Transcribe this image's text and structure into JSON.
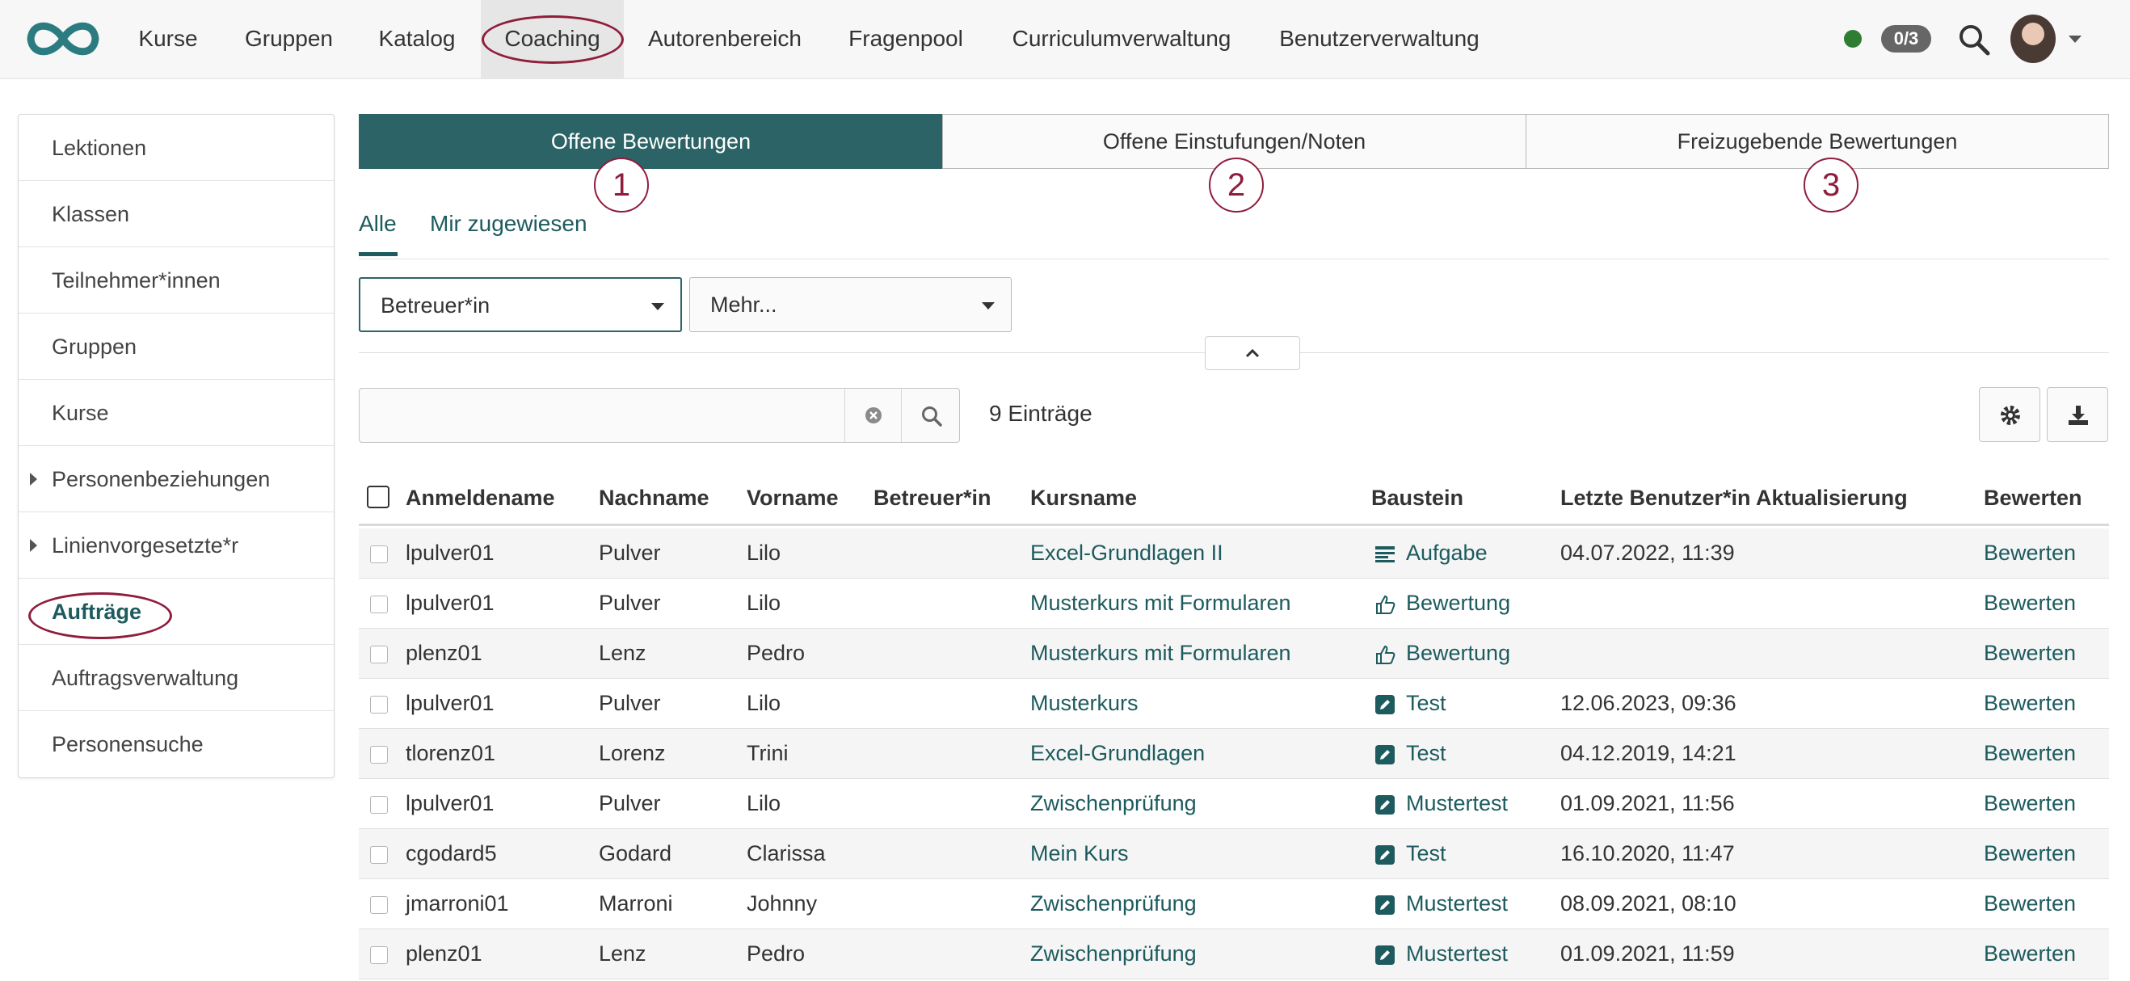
{
  "nav": {
    "items": [
      "Kurse",
      "Gruppen",
      "Katalog",
      "Coaching",
      "Autorenbereich",
      "Fragenpool",
      "Curriculumverwaltung",
      "Benutzerverwaltung"
    ],
    "active": "Coaching",
    "logo_icon": "infinity-logo-icon",
    "status_color": "#2e7d32",
    "badge": "0/3",
    "search_icon": "search-icon",
    "caret_icon": "caret-down-icon"
  },
  "sidebar": {
    "items": [
      "Lektionen",
      "Klassen",
      "Teilnehmer*innen",
      "Gruppen",
      "Kurse",
      "Personenbeziehungen",
      "Linienvorgesetzte*r",
      "Aufträge",
      "Auftragsverwaltung",
      "Personensuche"
    ],
    "active": "Aufträge"
  },
  "tabs": {
    "items": [
      "Offene Bewertungen",
      "Offene Einstufungen/Noten",
      "Freizugebende Bewertungen"
    ],
    "active": 0,
    "markers": [
      "1",
      "2",
      "3"
    ]
  },
  "subtabs": {
    "items": [
      "Alle",
      "Mir zugewiesen"
    ],
    "active": 0
  },
  "filters": {
    "coach": "Betreuer*in",
    "more": "Mehr..."
  },
  "search": {
    "value": "",
    "placeholder": ""
  },
  "entries": "9 Einträge",
  "table": {
    "columns": [
      "Anmeldename",
      "Nachname",
      "Vorname",
      "Betreuer*in",
      "Kursname",
      "Baustein",
      "Letzte Benutzer*in Aktualisierung",
      "Bewerten"
    ],
    "rows": [
      {
        "login": "lpulver01",
        "last": "Pulver",
        "first": "Lilo",
        "coach": "",
        "course": "Excel-Grundlagen II",
        "node": "Aufgabe",
        "node_icon": "task-icon",
        "updated": "04.07.2022, 11:39",
        "action": "Bewerten"
      },
      {
        "login": "lpulver01",
        "last": "Pulver",
        "first": "Lilo",
        "coach": "",
        "course": "Musterkurs mit Formularen",
        "node": "Bewertung",
        "node_icon": "thumbs-up-icon",
        "updated": "",
        "action": "Bewerten"
      },
      {
        "login": "plenz01",
        "last": "Lenz",
        "first": "Pedro",
        "coach": "",
        "course": "Musterkurs mit Formularen",
        "node": "Bewertung",
        "node_icon": "thumbs-up-icon",
        "updated": "",
        "action": "Bewerten"
      },
      {
        "login": "lpulver01",
        "last": "Pulver",
        "first": "Lilo",
        "coach": "",
        "course": "Musterkurs",
        "node": "Test",
        "node_icon": "test-edit-icon",
        "updated": "12.06.2023, 09:36",
        "action": "Bewerten"
      },
      {
        "login": "tlorenz01",
        "last": "Lorenz",
        "first": "Trini",
        "coach": "",
        "course": "Excel-Grundlagen",
        "node": "Test",
        "node_icon": "test-edit-icon",
        "updated": "04.12.2019, 14:21",
        "action": "Bewerten"
      },
      {
        "login": "lpulver01",
        "last": "Pulver",
        "first": "Lilo",
        "coach": "",
        "course": "Zwischenprüfung",
        "node": "Mustertest",
        "node_icon": "test-edit-icon",
        "updated": "01.09.2021, 11:56",
        "action": "Bewerten"
      },
      {
        "login": "cgodard5",
        "last": "Godard",
        "first": "Clarissa",
        "coach": "",
        "course": "Mein Kurs",
        "node": "Test",
        "node_icon": "test-edit-icon",
        "updated": "16.10.2020, 11:47",
        "action": "Bewerten"
      },
      {
        "login": "jmarroni01",
        "last": "Marroni",
        "first": "Johnny",
        "coach": "",
        "course": "Zwischenprüfung",
        "node": "Mustertest",
        "node_icon": "test-edit-icon",
        "updated": "08.09.2021, 08:10",
        "action": "Bewerten"
      },
      {
        "login": "plenz01",
        "last": "Lenz",
        "first": "Pedro",
        "coach": "",
        "course": "Zwischenprüfung",
        "node": "Mustertest",
        "node_icon": "test-edit-icon",
        "updated": "01.09.2021, 11:59",
        "action": "Bewerten"
      }
    ]
  },
  "colors": {
    "accent": "#2b6366",
    "link": "#1d5b5e",
    "marker": "#8f1d3c"
  }
}
